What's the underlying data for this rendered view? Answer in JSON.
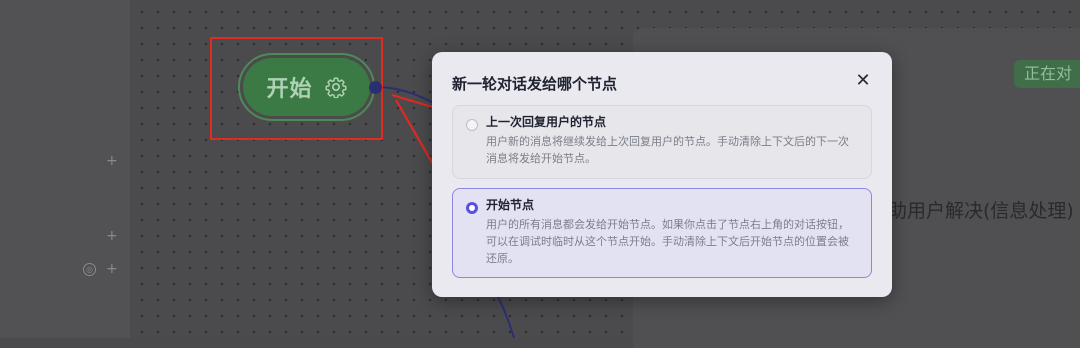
{
  "canvas": {
    "start_node": {
      "label": "开始",
      "icon": "gear-icon"
    }
  },
  "background": {
    "status_badge": "正在对",
    "partial_text": "助用户解决(信息处理)"
  },
  "dialog": {
    "title": "新一轮对话发给哪个节点",
    "close_icon": "close-icon",
    "options": [
      {
        "title": "上一次回复用户的节点",
        "description": "用户新的消息将继续发给上次回复用户的节点。手动清除上下文后的下一次消息将发给开始节点。",
        "selected": false
      },
      {
        "title": "开始节点",
        "description": "用户的所有消息都会发给开始节点。如果你点击了节点右上角的对话按钮，可以在调试时临时从这个节点开始。手动清除上下文后开始节点的位置会被还原。",
        "selected": true
      }
    ]
  },
  "colors": {
    "accent": "#5b4ee0",
    "node_green": "#3c7a45",
    "annotation_red": "#e02a22"
  }
}
